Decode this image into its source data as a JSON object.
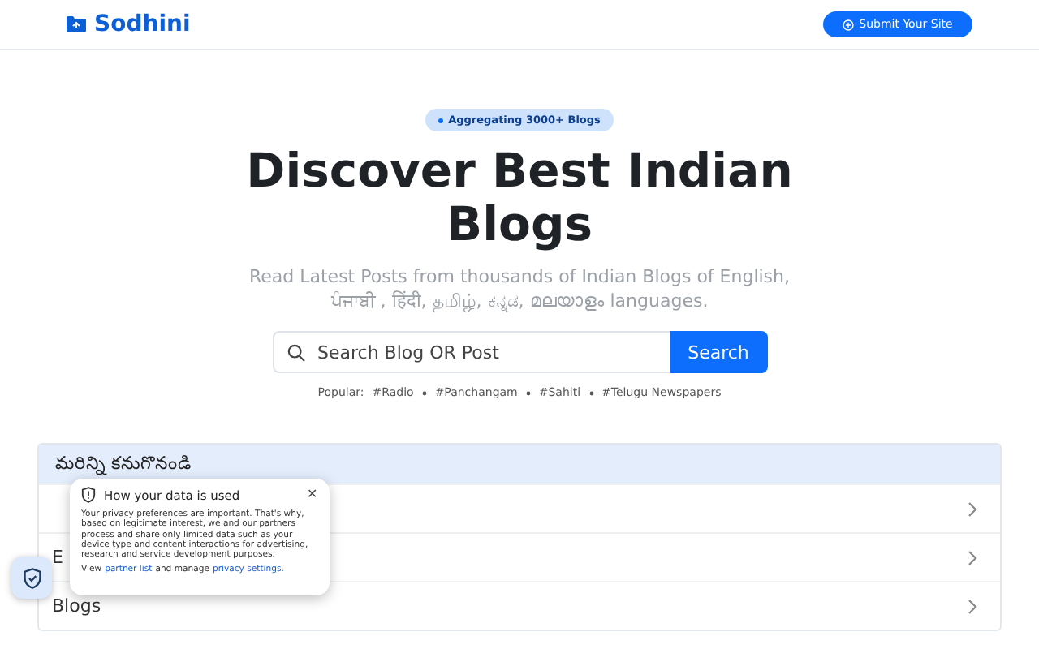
{
  "header": {
    "brand": "Sodhini",
    "submit_button": "Submit Your Site"
  },
  "hero": {
    "badge": "Aggregating 3000+ Blogs",
    "title": "Discover Best Indian Blogs",
    "subtitle_line_1": "Read Latest Posts from thousands of Indian Blogs of English,",
    "subtitle_line_2": "ਪੰਜਾਬੀ , हिंदी, தமிழ், ಕನ್ನಡ, മലയാളം languages."
  },
  "search": {
    "placeholder": "Search Blog OR Post",
    "button": "Search"
  },
  "popular": {
    "label": "Popular:",
    "tags": [
      "#Radio",
      "#Panchangam",
      "#Sahiti",
      "#Telugu Newspapers"
    ]
  },
  "discover": {
    "title": "మరిన్ని కనుగొనండి",
    "rows": [
      {},
      {
        "label": "E"
      },
      {
        "label": "Blogs"
      }
    ]
  },
  "privacy_popup": {
    "title": "How your data is used",
    "close": "✕",
    "body": "Your privacy preferences are important. That's why, based on legitimate interest, we and our partners process and share only limited data such as your device type and content interactions for advertising, research and service development purposes.",
    "footer_prefix": "View",
    "partner_link": "partner list",
    "footer_middle": "and manage",
    "settings_link": "privacy settings."
  }
}
